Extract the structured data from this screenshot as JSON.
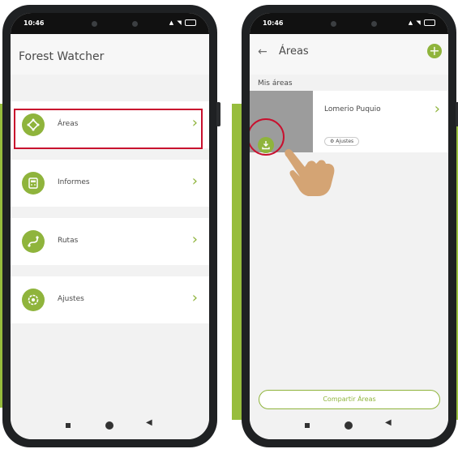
{
  "left_phone": {
    "status_time": "10:46",
    "app_title": "Forest Watcher",
    "menu": [
      {
        "label": "Áreas",
        "icon": "areas-icon"
      },
      {
        "label": "Informes",
        "icon": "reports-icon"
      },
      {
        "label": "Rutas",
        "icon": "routes-icon"
      },
      {
        "label": "Ajustes",
        "icon": "settings-icon"
      }
    ]
  },
  "right_phone": {
    "status_time": "10:46",
    "title": "Áreas",
    "section_label": "Mis áreas",
    "area": {
      "name": "Lomerio Puquio",
      "settings_pill": "Ajustes"
    },
    "share_button": "Compartir Áreas"
  },
  "colors": {
    "accent_green": "#8fb43c",
    "highlight_red": "#c8102e",
    "background_green": "#97bd3d"
  }
}
